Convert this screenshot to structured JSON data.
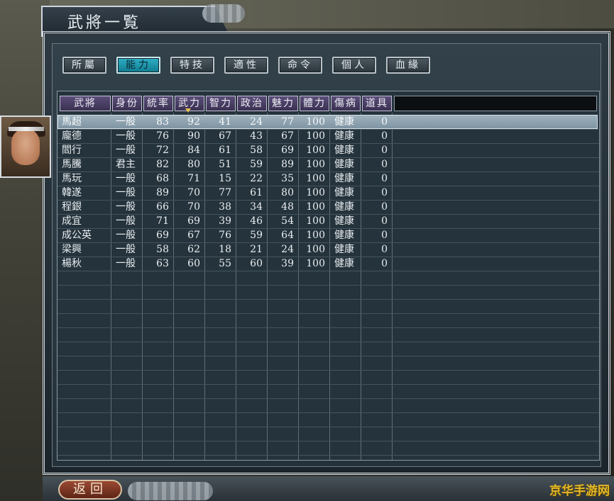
{
  "window": {
    "title": "武將一覧"
  },
  "tabs": [
    {
      "label": "所屬",
      "active": false
    },
    {
      "label": "能力",
      "active": true
    },
    {
      "label": "特技",
      "active": false
    },
    {
      "label": "適性",
      "active": false
    },
    {
      "label": "命令",
      "active": false
    },
    {
      "label": "個人",
      "active": false
    },
    {
      "label": "血緣",
      "active": false
    }
  ],
  "table": {
    "headers": [
      "武將",
      "身份",
      "統率",
      "武力",
      "智力",
      "政治",
      "魅力",
      "體力",
      "傷病",
      "道具"
    ],
    "sorted_by": "武力",
    "selected_row": 0,
    "rows": [
      [
        "馬超",
        "一般",
        "83",
        "92",
        "41",
        "24",
        "77",
        "100",
        "健康",
        "0"
      ],
      [
        "龐德",
        "一般",
        "76",
        "90",
        "67",
        "43",
        "67",
        "100",
        "健康",
        "0"
      ],
      [
        "閻行",
        "一般",
        "72",
        "84",
        "61",
        "58",
        "69",
        "100",
        "健康",
        "0"
      ],
      [
        "馬騰",
        "君主",
        "82",
        "80",
        "51",
        "59",
        "89",
        "100",
        "健康",
        "0"
      ],
      [
        "馬玩",
        "一般",
        "68",
        "71",
        "15",
        "22",
        "35",
        "100",
        "健康",
        "0"
      ],
      [
        "韓遂",
        "一般",
        "89",
        "70",
        "77",
        "61",
        "80",
        "100",
        "健康",
        "0"
      ],
      [
        "程銀",
        "一般",
        "66",
        "70",
        "38",
        "34",
        "48",
        "100",
        "健康",
        "0"
      ],
      [
        "成宜",
        "一般",
        "71",
        "69",
        "39",
        "46",
        "54",
        "100",
        "健康",
        "0"
      ],
      [
        "成公英",
        "一般",
        "69",
        "67",
        "76",
        "59",
        "64",
        "100",
        "健康",
        "0"
      ],
      [
        "梁興",
        "一般",
        "58",
        "62",
        "18",
        "21",
        "24",
        "100",
        "健康",
        "0"
      ],
      [
        "楊秋",
        "一般",
        "63",
        "60",
        "55",
        "60",
        "39",
        "100",
        "健康",
        "0"
      ]
    ]
  },
  "back_button": {
    "label": "返回"
  },
  "watermark": "京华手游网",
  "colors": {
    "active_tab": "#1fa0b8",
    "header_bg": "#4a3f66",
    "selected_row": "#8fa3b0"
  }
}
